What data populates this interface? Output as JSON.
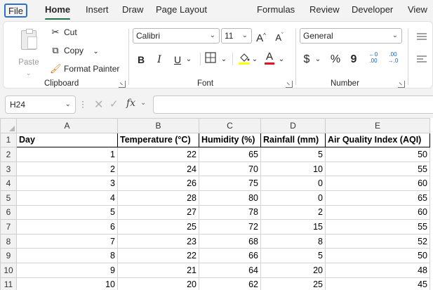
{
  "menu": {
    "tabs": [
      "File",
      "Home",
      "Insert",
      "Draw",
      "Page Layout",
      "Formulas",
      "Review",
      "Developer",
      "View"
    ]
  },
  "ribbon": {
    "clipboard": {
      "paste_label": "Paste",
      "cut_label": "Cut",
      "copy_label": "Copy",
      "format_painter_label": "Format Painter",
      "group_label": "Clipboard"
    },
    "font": {
      "font_name": "Calibri",
      "font_size": "11",
      "bold": "B",
      "italic": "I",
      "underline": "U",
      "group_label": "Font"
    },
    "number": {
      "format": "General",
      "currency": "$",
      "percent": "%",
      "comma": "9",
      "inc_decimal": "←0\n.00",
      "dec_decimal": ".00\n→.0",
      "group_label": "Number"
    }
  },
  "formula_bar": {
    "name_box": "H24",
    "fx": "fx",
    "formula": ""
  },
  "sheet": {
    "columns": [
      "A",
      "B",
      "C",
      "D",
      "E"
    ],
    "row_numbers": [
      "1",
      "2",
      "3",
      "4",
      "5",
      "6",
      "7",
      "8",
      "9",
      "10",
      "11"
    ],
    "headers": [
      "Day",
      "Temperature (°C)",
      "Humidity (%)",
      "Rainfall (mm)",
      "Air Quality Index (AQI)"
    ],
    "rows": [
      [
        "1",
        "22",
        "65",
        "5",
        "50"
      ],
      [
        "2",
        "24",
        "70",
        "10",
        "55"
      ],
      [
        "3",
        "26",
        "75",
        "0",
        "60"
      ],
      [
        "4",
        "28",
        "80",
        "0",
        "65"
      ],
      [
        "5",
        "27",
        "78",
        "2",
        "60"
      ],
      [
        "6",
        "25",
        "72",
        "15",
        "55"
      ],
      [
        "7",
        "23",
        "68",
        "8",
        "52"
      ],
      [
        "8",
        "22",
        "66",
        "5",
        "50"
      ],
      [
        "9",
        "21",
        "64",
        "20",
        "48"
      ],
      [
        "10",
        "20",
        "62",
        "25",
        "45"
      ]
    ]
  },
  "colors": {
    "accent_green": "#1f7145",
    "file_border": "#2f6ecb",
    "font_color_bar": "#e81123"
  }
}
